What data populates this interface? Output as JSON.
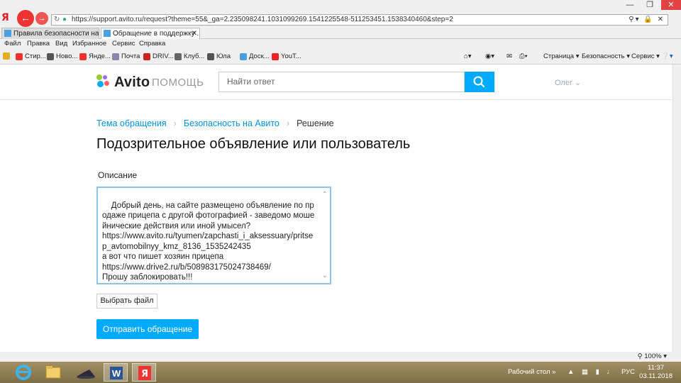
{
  "browser": {
    "url": "https://support.avito.ru/request?theme=55&_ga=2.235098241.1031099269.1541225548-511253451.1538340460&step=2",
    "tabs": [
      {
        "label": "Правила безопасности на Ав..."
      },
      {
        "label": "Обращение в поддержку ..."
      }
    ],
    "menu": [
      "Файл",
      "Правка",
      "Вид",
      "Избранное",
      "Сервис",
      "Справка"
    ],
    "favorites": [
      "Стир...",
      "Ново...",
      "Янде...",
      "Почта",
      "DRIV...",
      "Клуб...",
      "Юла",
      "Доск...",
      "YouT..."
    ],
    "toolbar_right": [
      "Страница ▾",
      "Безопасность ▾",
      "Сервис ▾"
    ],
    "zoom": "100%"
  },
  "site": {
    "logo": "Avito",
    "logo_suffix": "ПОМОЩЬ",
    "search_placeholder": "Найти ответ",
    "user": "Олег"
  },
  "breadcrumbs": [
    "Тема обращения",
    "Безопасность на Авито",
    "Решение"
  ],
  "title": "Подозрительное объявление или пользователь",
  "form": {
    "description_label": "Описание",
    "description_value": "Добрый день, на сайте размещено объявление по продаже прицепа с другой фотографией - заведомо мошейнические действия или иной умысел?\nhttps://www.avito.ru/tyumen/zapchasti_i_aksessuary/pritsep_avtomobilnyy_kmz_8136_1535242435\nа вот что пишет хозяин прицепа\nhttps://www.drive2.ru/b/508983175024738469/\nПрошу заблокировать!!!",
    "file_button": "Выбрать файл",
    "submit_button": "Отправить обращение"
  },
  "taskbar": {
    "desktop_label": "Рабочий стол",
    "lang": "РУС",
    "time": "11:37",
    "date": "03.11.2018"
  },
  "colors": {
    "accent": "#00aaff",
    "link": "#0091d9"
  }
}
